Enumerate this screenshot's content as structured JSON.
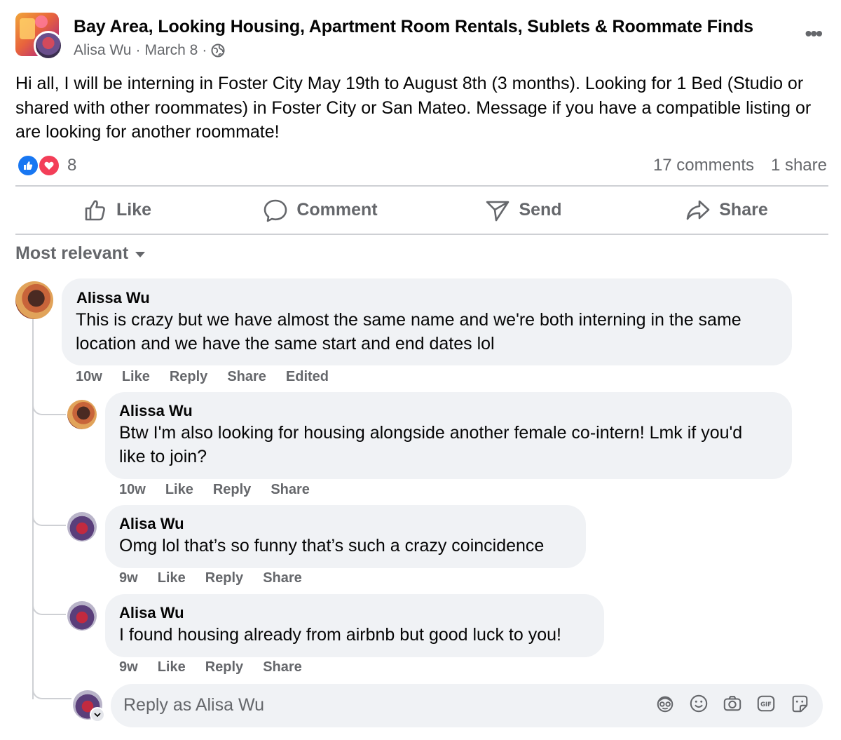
{
  "post": {
    "group_name": "Bay Area, Looking Housing, Apartment Room Rentals, Sublets & Roommate Finds",
    "author": "Alisa Wu",
    "sep1": "·",
    "date": "March 8",
    "sep2": "·",
    "more_icon": "•••",
    "privacy_icon": "globe-icon",
    "body": "Hi all, I will be interning in Foster City May 19th to August 8th (3 months). Looking for 1 Bed (Studio or shared with other roommates) in Foster City or San Mateo. Message if you have a compatible listing or are looking for another roommate!"
  },
  "reactions": {
    "types": [
      "like",
      "love"
    ],
    "count": "8",
    "comments": "17 comments",
    "shares": "1 share"
  },
  "actions": {
    "like": "Like",
    "comment": "Comment",
    "send": "Send",
    "share": "Share"
  },
  "sort": {
    "label": "Most relevant"
  },
  "comments": [
    {
      "author": "Alissa Wu",
      "text": "This is crazy but we have almost the same name and we're both interning in the same location and we have the same start and end dates lol",
      "time": "10w",
      "like": "Like",
      "reply": "Reply",
      "share": "Share",
      "edited": "Edited"
    },
    {
      "author": "Alissa Wu",
      "text": "Btw I'm also looking for housing alongside another female co-intern! Lmk if you'd like to join?",
      "time": "10w",
      "like": "Like",
      "reply": "Reply",
      "share": "Share"
    },
    {
      "author": "Alisa Wu",
      "text": "Omg lol that’s so funny that’s such a crazy coincidence",
      "time": "9w",
      "like": "Like",
      "reply": "Reply",
      "share": "Share"
    },
    {
      "author": "Alisa Wu",
      "text": "I found housing already from airbnb but good luck to you!",
      "time": "9w",
      "like": "Like",
      "reply": "Reply",
      "share": "Share"
    }
  ],
  "reply_box": {
    "placeholder": "Reply as Alisa Wu",
    "icons": [
      "avatar-sticker-icon",
      "emoji-icon",
      "camera-icon",
      "gif-icon",
      "sticker-icon"
    ]
  },
  "colors": {
    "text": "#050505",
    "secondary": "#65676b",
    "bubble": "#f0f2f5",
    "like_blue": "#1877f2",
    "love_red": "#f33e58",
    "divider": "#ced0d4"
  }
}
